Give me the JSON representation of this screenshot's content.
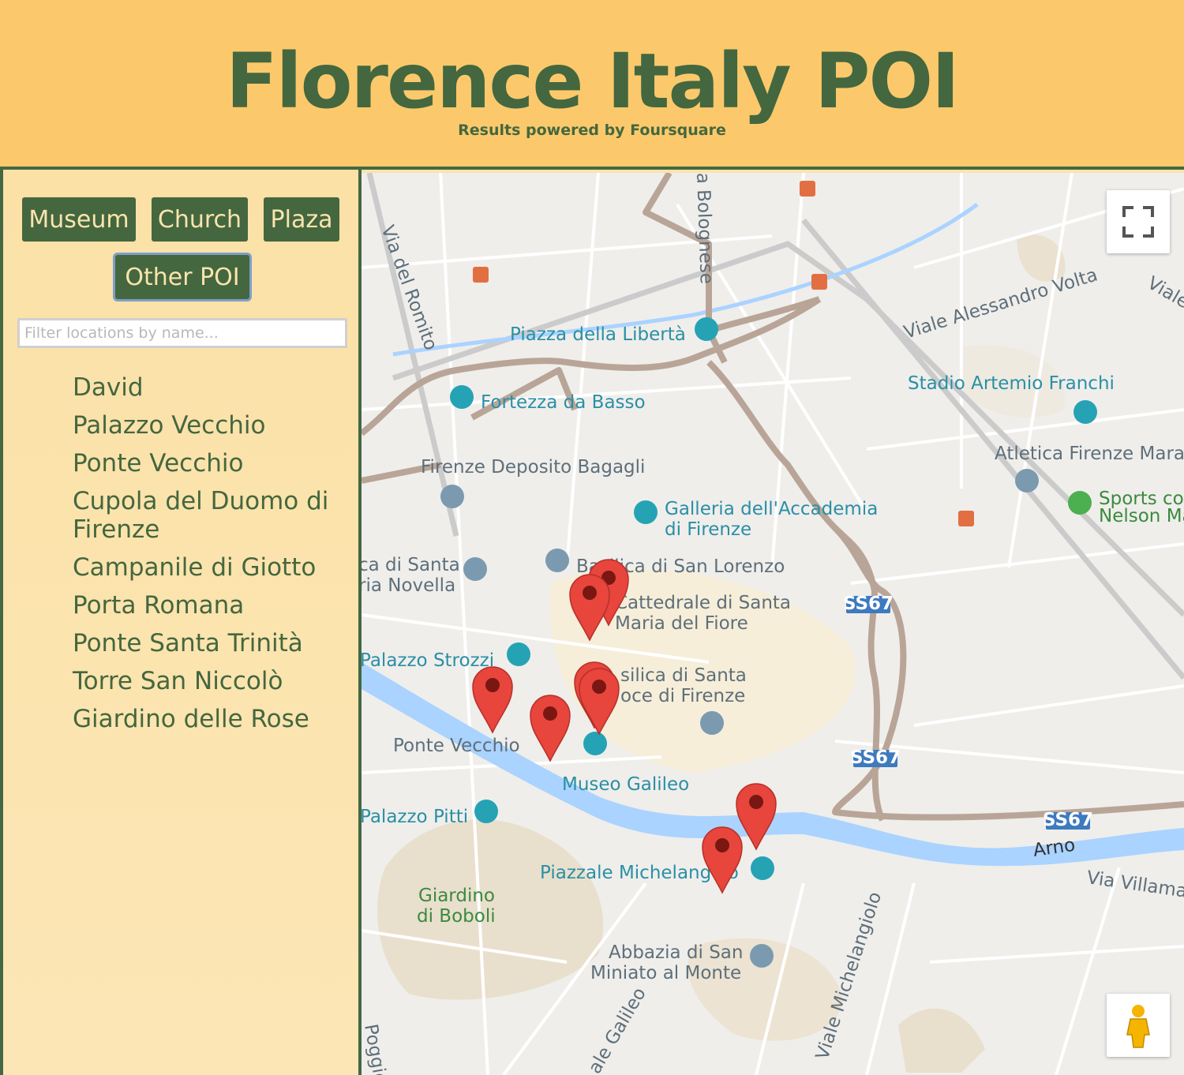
{
  "header": {
    "title": "Florence Italy POI",
    "subtitle": "Results powered by Foursquare"
  },
  "sidebar": {
    "buttons": [
      "Museum",
      "Church",
      "Plaza",
      "Other POI"
    ],
    "filter_placeholder": "Filter locations by name...",
    "locations": [
      "David",
      "Palazzo Vecchio",
      "Ponte Vecchio",
      "Cupola del Duomo di Firenze",
      "Campanile di Giotto",
      "Porta Romana",
      "Ponte Santa Trinità",
      "Torre San Niccolò",
      "Giardino delle Rose"
    ]
  },
  "map": {
    "labels": {
      "piazza_liberta": "Piazza della Libertà",
      "fortezza": "Fortezza da Basso",
      "deposito": "Firenze Deposito Bagagli",
      "accademia_1": "Galleria dell'Accademia",
      "accademia_2": "di Firenze",
      "stadio": "Stadio Artemio Franchi",
      "atletica": "Atletica Firenze Mara",
      "sports_1": "Sports co",
      "sports_2": "Nelson Mar",
      "san_lorenzo": "Basilica di San Lorenzo",
      "cattedrale_1": "Cattedrale di Santa",
      "cattedrale_2": "Maria del Fiore",
      "smn_1": "ca di Santa",
      "smn_2": "ria Novella",
      "strozzi": "Palazzo Strozzi",
      "croce_1": "silica di Santa",
      "croce_2": "oce di Firenze",
      "ponte_vecchio": "Ponte Vecchio",
      "galileo": "Museo Galileo",
      "pitti": "Palazzo Pitti",
      "michelangelo": "Piazzale Michelangelo",
      "boboli_1": "Giardino",
      "boboli_2": "di Boboli",
      "abbazia_1": "Abbazia di San",
      "abbazia_2": "Miniato al Monte",
      "arno": "Arno",
      "via_romito": "Via del Romito",
      "bolognese": "a Bolognese",
      "viale_volta": "Viale Alessandro Volta",
      "viale_e": "Viale",
      "via_villamagna": "Via Villamagn",
      "viale_michelangiolo": "Viale Michelangiolo",
      "viale_galileo": "ale Galileo",
      "poggio": "Poggio",
      "ss67": "SS67"
    },
    "colors": {
      "marker": "#e8453c",
      "river": "#aad3ff",
      "road": "#b9a597",
      "poi_teal": "#25a3b5",
      "poi_gray": "#7b9ab0",
      "transit": "#e26f42"
    }
  }
}
